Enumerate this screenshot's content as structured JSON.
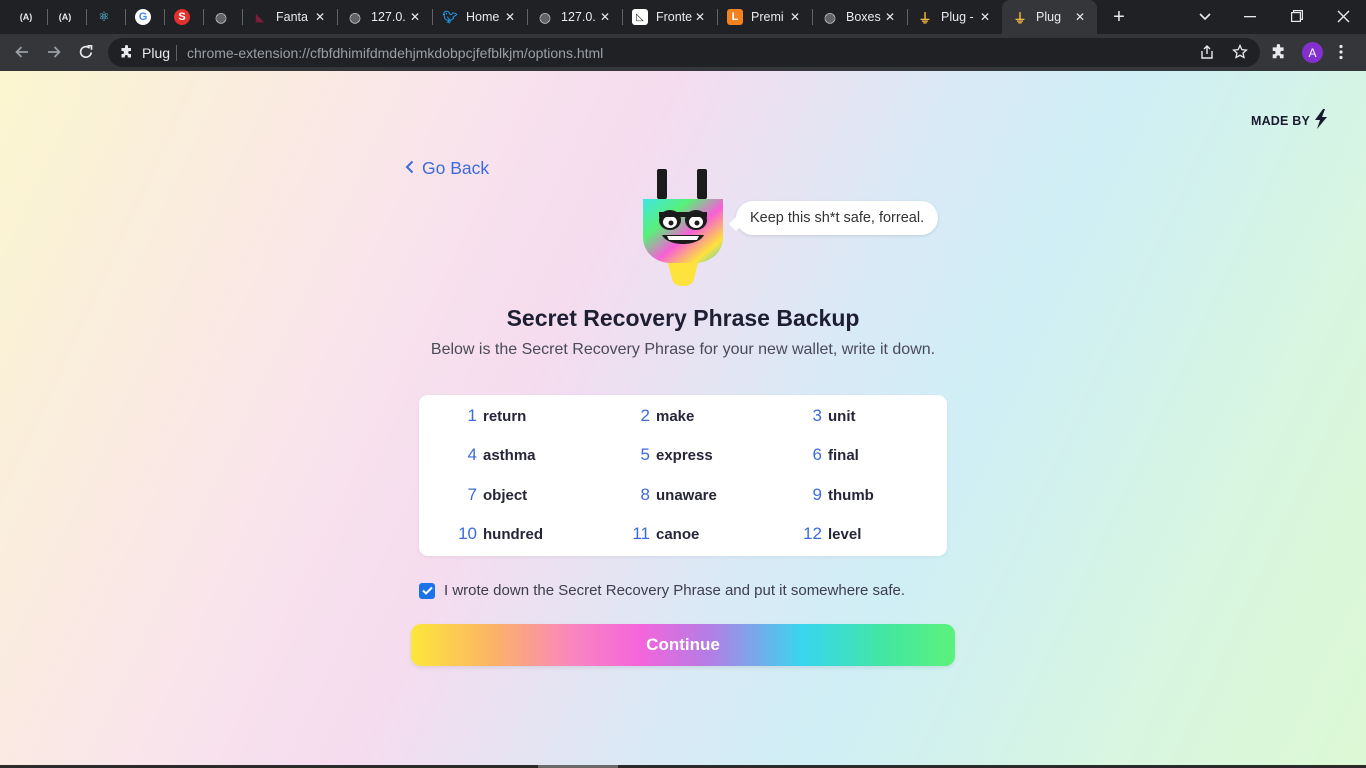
{
  "browser": {
    "tabs": [
      {
        "title": "",
        "favicon": "angular-icon",
        "active": false
      },
      {
        "title": "",
        "favicon": "angular-icon",
        "active": false
      },
      {
        "title": "",
        "favicon": "react-icon",
        "active": false
      },
      {
        "title": "",
        "favicon": "google-icon",
        "active": false
      },
      {
        "title": "",
        "favicon": "s-brand-icon",
        "active": false
      },
      {
        "title": "",
        "favicon": "globe-icon",
        "active": false
      },
      {
        "title": "Fanta",
        "favicon": "fantom-icon",
        "active": false
      },
      {
        "title": "127.0.",
        "favicon": "globe-icon",
        "active": false
      },
      {
        "title": "Home",
        "favicon": "twitter-icon",
        "active": false
      },
      {
        "title": "127.0.",
        "favicon": "globe-icon",
        "active": false
      },
      {
        "title": "Fronte",
        "favicon": "frontend-icon",
        "active": false
      },
      {
        "title": "Premi",
        "favicon": "ls-brand-icon",
        "active": false
      },
      {
        "title": "Boxes",
        "favicon": "globe-icon",
        "active": false
      },
      {
        "title": "Plug -",
        "favicon": "plug-icon",
        "active": false
      },
      {
        "title": "Plug",
        "favicon": "plug-icon",
        "active": true
      }
    ],
    "new_tab_label": "+",
    "omnibox": {
      "site_label": "Plug",
      "url": "chrome-extension://cfbfdhimifdmdehjmkdobpcjfefblkjm/options.html"
    },
    "profile_initial": "A"
  },
  "page": {
    "made_by_label": "MADE BY",
    "go_back_label": "Go Back",
    "speech_bubble": "Keep this sh*t safe, forreal.",
    "title": "Secret Recovery Phrase Backup",
    "subtitle": "Below is the Secret Recovery Phrase for your new wallet, write it down.",
    "words": [
      {
        "n": "1",
        "word": "return"
      },
      {
        "n": "2",
        "word": "make"
      },
      {
        "n": "3",
        "word": "unit"
      },
      {
        "n": "4",
        "word": "asthma"
      },
      {
        "n": "5",
        "word": "express"
      },
      {
        "n": "6",
        "word": "final"
      },
      {
        "n": "7",
        "word": "object"
      },
      {
        "n": "8",
        "word": "unaware"
      },
      {
        "n": "9",
        "word": "thumb"
      },
      {
        "n": "10",
        "word": "hundred"
      },
      {
        "n": "11",
        "word": "canoe"
      },
      {
        "n": "12",
        "word": "level"
      }
    ],
    "confirm_checked": true,
    "confirm_label": "I wrote down the Secret Recovery Phrase and put it somewhere safe.",
    "continue_label": "Continue"
  },
  "colors": {
    "accent_blue": "#3b6cd9",
    "checkbox_blue": "#1a73e8",
    "chrome_dark": "#202124",
    "chrome_toolbar": "#35363a"
  }
}
